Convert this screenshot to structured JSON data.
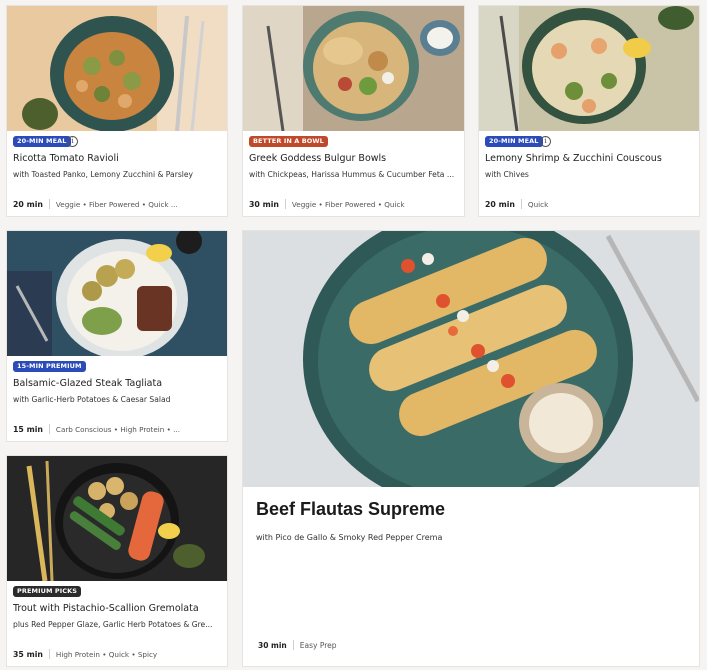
{
  "colors": {
    "badge_blue": "#2a4bb8",
    "badge_red": "#c0492b",
    "badge_dark": "#2b2b2b"
  },
  "cards": [
    {
      "badge": "20-MIN MEAL",
      "badge_color": "#2a4bb8",
      "info_icon": "i",
      "title": "Ricotta Tomato Ravioli",
      "subtitle": "with Toasted Panko, Lemony Zucchini & Parsley",
      "time": "20 min",
      "tags": "Veggie • Fiber Powered • Quick ..."
    },
    {
      "badge": "BETTER IN A BOWL",
      "badge_color": "#c0492b",
      "title": "Greek Goddess Bulgur Bowls",
      "subtitle": "with Chickpeas, Harissa Hummus & Cucumber Feta ...",
      "time": "30 min",
      "tags": "Veggie • Fiber Powered • Quick"
    },
    {
      "badge": "20-MIN MEAL",
      "badge_color": "#2a4bb8",
      "info_icon": "i",
      "title": "Lemony Shrimp & Zucchini Couscous",
      "subtitle": "with Chives",
      "time": "20 min",
      "tags": "Quick"
    },
    {
      "badge": "15-MIN PREMIUM",
      "badge_color": "#2a4bb8",
      "title": "Balsamic-Glazed Steak Tagliata",
      "subtitle": "with Garlic-Herb Potatoes & Caesar Salad",
      "time": "15 min",
      "tags": "Carb Conscious • High Protein • ..."
    },
    {
      "badge": "PREMIUM PICKS",
      "badge_color": "#2b2b2b",
      "title": "Trout with Pistachio-Scallion Gremolata",
      "subtitle": "plus Red Pepper Glaze, Garlic Herb Potatoes & Gre...",
      "time": "35 min",
      "tags": "High Protein • Quick • Spicy"
    }
  ],
  "hero": {
    "title": "Beef Flautas Supreme",
    "subtitle": "with Pico de Gallo & Smoky Red Pepper Crema",
    "time": "30 min",
    "tags": "Easy Prep"
  }
}
